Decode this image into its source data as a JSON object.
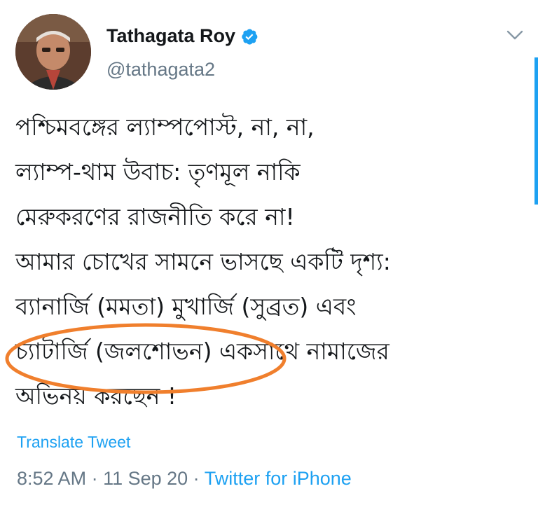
{
  "author": {
    "display_name": "Tathagata Roy",
    "handle": "@tathagata2",
    "verified": true
  },
  "tweet": {
    "lines": [
      "পশ্চিমবঙ্গের ল্যাম্পপোস্ট, না, না,",
      "ল্যাম্প-থাম উবাচ: তৃণমূল নাকি",
      "মেরুকরণের রাজনীতি করে না!",
      "আমার চোখের সামনে ভাসছে একটি দৃশ্য:",
      "ব্যানার্জি (মমতা) মুখার্জি (সুব্রত) এবং",
      "চ্যাটার্জি  (জলশোভন) একসাথে নামাজের",
      "অভিনয় করছেন !"
    ],
    "translate_label": "Translate Tweet"
  },
  "meta": {
    "time": "8:52 AM",
    "separator": " · ",
    "date": "11 Sep 20",
    "source": "Twitter for iPhone"
  },
  "icons": {
    "verified": "verified-badge-icon",
    "menu": "chevron-down-icon"
  },
  "colors": {
    "link": "#1da1f2",
    "secondary_text": "#657786",
    "annotation": "#f07f2d"
  }
}
